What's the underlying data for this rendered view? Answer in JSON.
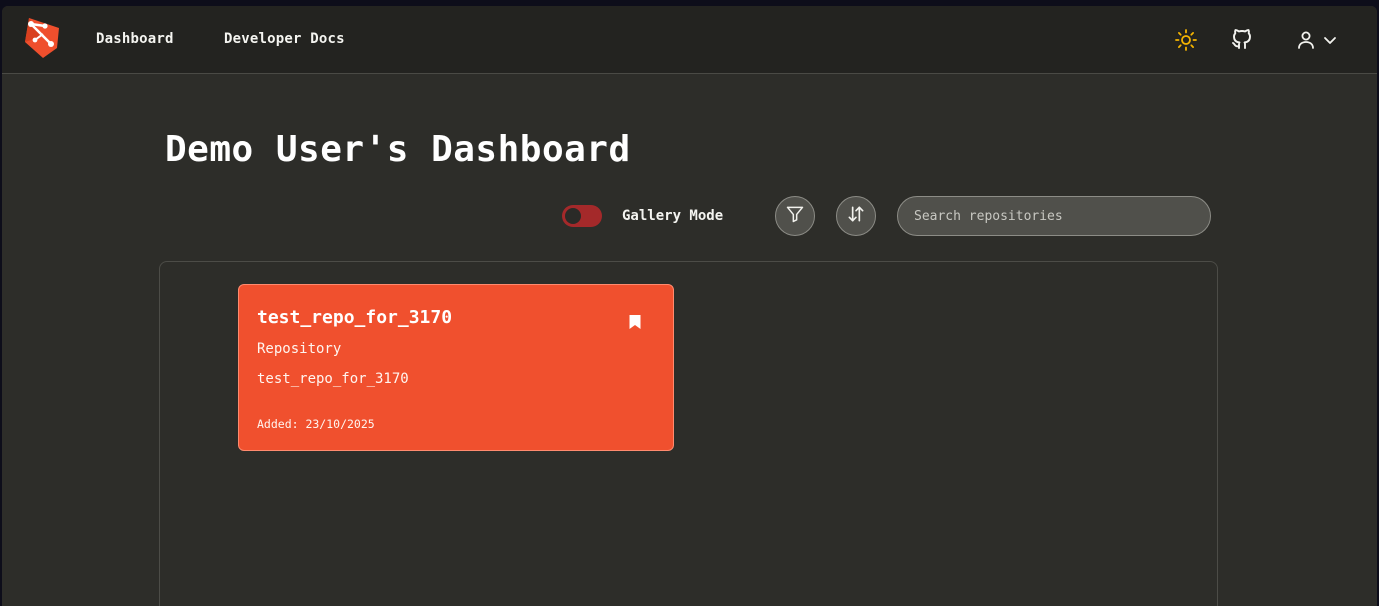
{
  "navbar": {
    "links": {
      "dashboard": "Dashboard",
      "developer_docs": "Developer Docs"
    },
    "icons": [
      "logo-icon",
      "sun-icon",
      "github-icon",
      "user-icon",
      "chevron-down-icon"
    ]
  },
  "page": {
    "title": "Demo User's Dashboard"
  },
  "controls": {
    "gallery_mode_label": "Gallery Mode",
    "gallery_mode_on": false,
    "search_placeholder": "Search repositories"
  },
  "repositories": [
    {
      "name": "test_repo_for_3170",
      "type": "Repository",
      "description": "test_repo_for_3170",
      "added": "Added: 23/10/2025",
      "bookmarked": true
    }
  ],
  "colors": {
    "accent": "#f0502e",
    "toggle_track": "#a4292a",
    "sun_icon": "#f5b400",
    "background": "#2d2d29",
    "navbar": "#232320"
  }
}
